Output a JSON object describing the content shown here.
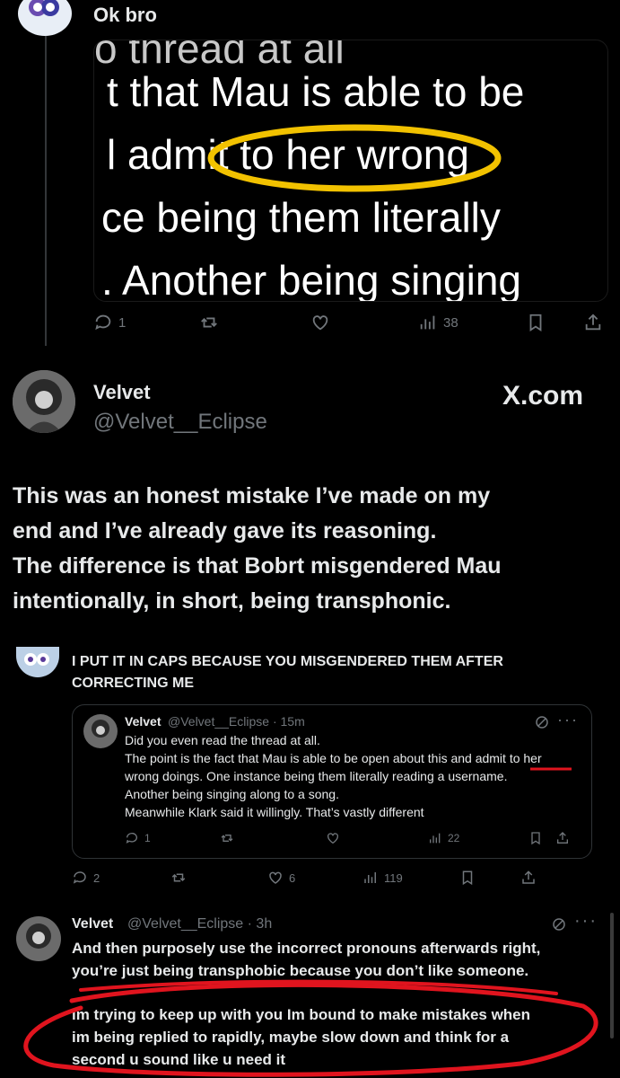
{
  "tweet1": {
    "reply_text": "Ok bro",
    "image_lines": [
      "t that Mau is able to be",
      "l admit to her wrong",
      "ce being them literally",
      ". Another being singing"
    ],
    "actions": {
      "replies": "1",
      "views": "38"
    }
  },
  "tweet2": {
    "name": "Velvet",
    "handle": "@Velvet__Eclipse",
    "watermark": "X.com",
    "body_lines": [
      "This was an honest mistake I’ve made on my",
      "end and I’ve already gave its reasoning.",
      "The difference is that Bobrt misgendered Mau",
      "intentionally, in short, being transphonic."
    ]
  },
  "tweet3": {
    "text_lines": [
      "I PUT IT IN CAPS BECAUSE YOU MISGENDERED THEM AFTER",
      "CORRECTING ME"
    ],
    "quote": {
      "name": "Velvet",
      "handle_time": "@Velvet__Eclipse · 15m",
      "lines": [
        "Did you even read the thread at all.",
        "The point is the fact that Mau is able to be open about this and admit to her",
        "wrong doings. One instance being them literally reading a username.",
        "Another being singing along to a song.",
        "Meanwhile Klark said it willingly. That’s vastly different"
      ],
      "replies": "1",
      "views": "22"
    },
    "actions": {
      "replies": "2",
      "likes": "6",
      "views": "119"
    }
  },
  "tweet4": {
    "name": "Velvet",
    "handle_time": "@Velvet__Eclipse · 3h",
    "lines": [
      "And then purposely use the incorrect pronouns afterwards right,",
      "you’re just being transphobic because you don’t like someone.",
      "im trying to keep up with you Im bound to make mistakes when",
      "im being replied to rapidly, maybe slow down and think for a",
      "second u sound like u need it"
    ]
  },
  "colors": {
    "background": "#000000",
    "text": "#e7e9ea",
    "muted": "#71767b",
    "highlight_yellow": "#f2c200",
    "annotation_red": "#e0141e"
  }
}
